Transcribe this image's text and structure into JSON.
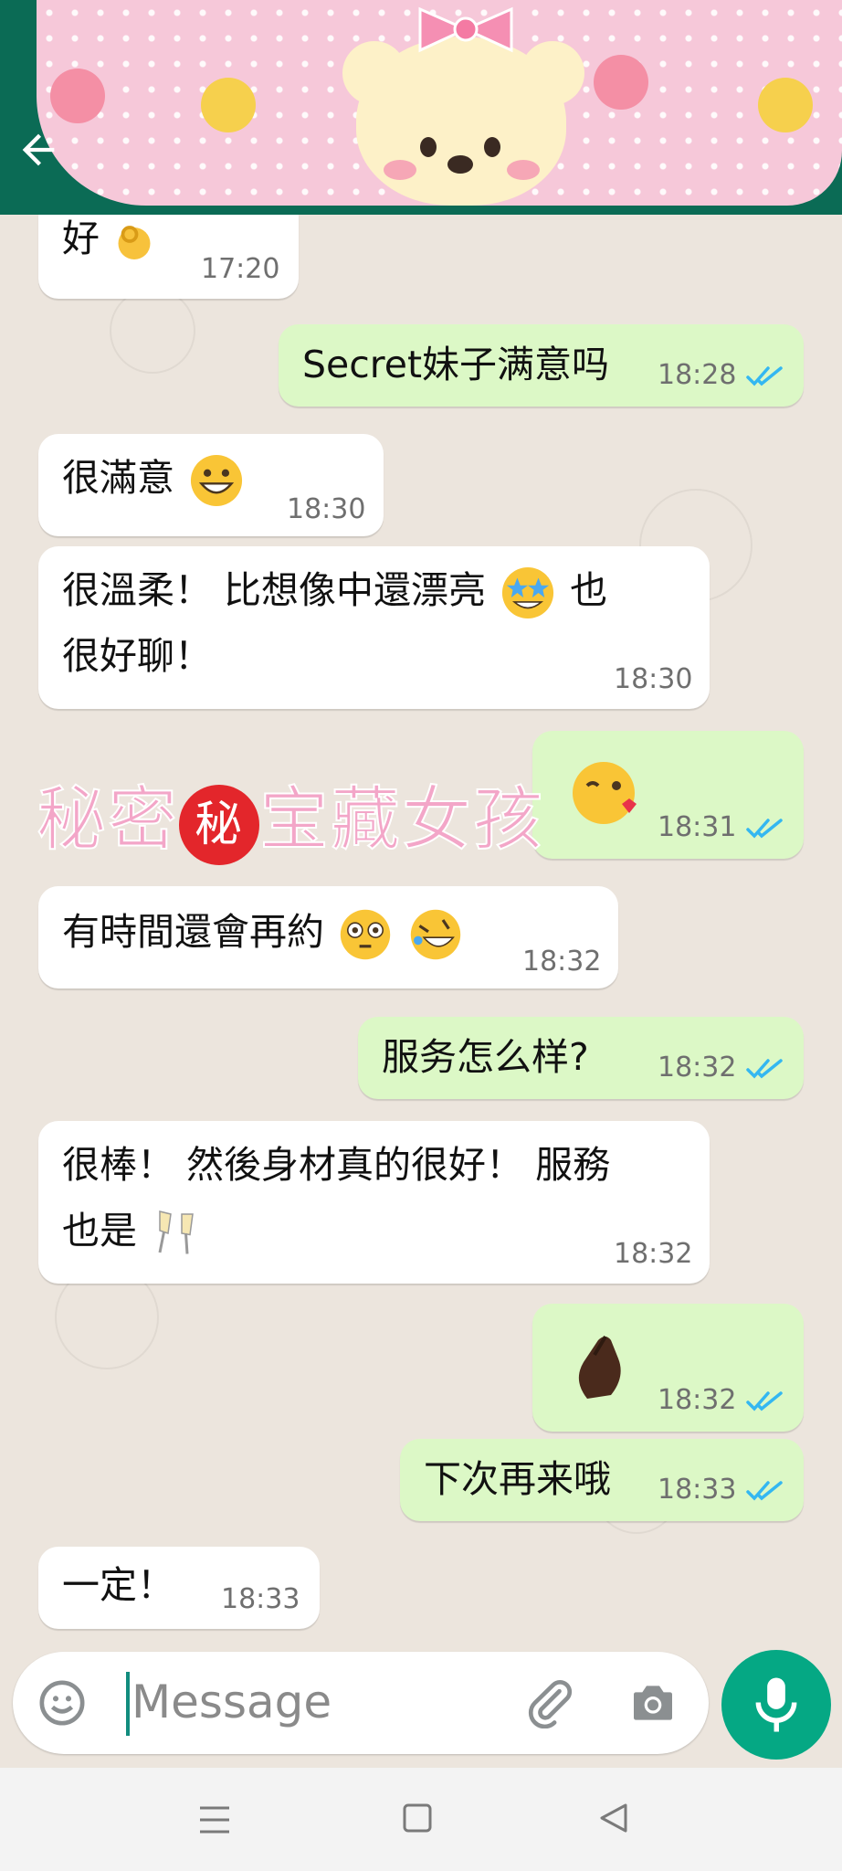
{
  "theme": {
    "header": "#0b6b55",
    "incoming": "#ffffff",
    "outgoing": "#dcf8c6",
    "tick": "#34b7f1",
    "mic": "#05a884"
  },
  "header": {
    "back_icon": "arrow-left-icon"
  },
  "messages": [
    {
      "side": "in",
      "text": "好",
      "emoji": [
        "ok-hand"
      ],
      "time": "17:20"
    },
    {
      "side": "out",
      "text": "Secret妹子满意吗",
      "time": "18:28",
      "read": true
    },
    {
      "side": "in",
      "text": "很滿意",
      "emoji": [
        "grinning-face"
      ],
      "time": "18:30"
    },
    {
      "side": "in",
      "line1": "很溫柔！ 比想像中還漂亮",
      "line1b": " 也",
      "line2": "很好聊！",
      "emoji": [
        "star-struck"
      ],
      "time": "18:30"
    },
    {
      "side": "out",
      "text": "",
      "emoji": [
        "face-blowing-kiss"
      ],
      "time": "18:31",
      "read": true
    },
    {
      "side": "in",
      "text": "有時間還會再約",
      "emoji": [
        "flushed-face",
        "rolling-laughing"
      ],
      "time": "18:32"
    },
    {
      "side": "out",
      "text": "服务怎么样?",
      "time": "18:32",
      "read": true
    },
    {
      "side": "in",
      "line1": "很棒！ 然後身材真的很好！ 服務",
      "line2": "也是",
      "emoji": [
        "clinking-glasses"
      ],
      "time": "18:32"
    },
    {
      "side": "out",
      "text": "",
      "emoji": [
        "finger-heart"
      ],
      "time": "18:32",
      "read": true
    },
    {
      "side": "out",
      "text": "下次再来哦",
      "time": "18:33",
      "read": true
    },
    {
      "side": "in",
      "text": "一定！",
      "time": "18:33"
    }
  ],
  "watermark": {
    "part1": "秘密",
    "badge": "秘",
    "part2": "宝藏女孩"
  },
  "composer": {
    "placeholder": "Message",
    "emoji_icon": "smiley-icon",
    "attach_icon": "paperclip-icon",
    "camera_icon": "camera-icon",
    "mic_icon": "microphone-icon"
  },
  "navbar": {
    "menu_icon": "menu-icon",
    "home_icon": "square-home-icon",
    "back_icon": "triangle-back-icon"
  }
}
